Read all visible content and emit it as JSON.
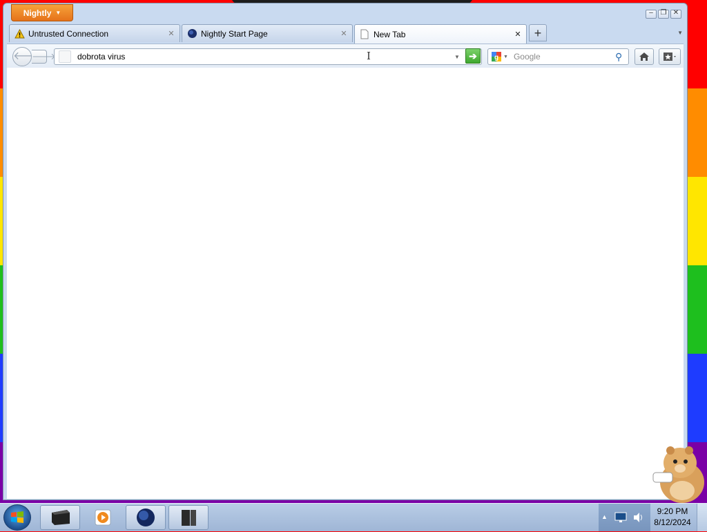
{
  "app": {
    "menu_label": "Nightly"
  },
  "tabs": [
    {
      "title": "Untrusted Connection",
      "icon": "warning-icon",
      "active": false
    },
    {
      "title": "Nightly Start Page",
      "icon": "nightly-globe-icon",
      "active": false
    },
    {
      "title": "New Tab",
      "icon": "blank-page-icon",
      "active": true
    }
  ],
  "navbar": {
    "url_value": "dobrota virus",
    "search_engine": "Google",
    "search_placeholder": "Google"
  },
  "taskbar": {
    "time": "9:20 PM",
    "date": "8/12/2024",
    "items": [
      "terminal-icon",
      "media-player-icon",
      "nightly-icon",
      "explorer-window-icon"
    ]
  },
  "colors": {
    "accent": "#e5721a",
    "go_button": "#3fa82f",
    "wallpaper_stripes": [
      "#ff0000",
      "#ff8c00",
      "#ffe600",
      "#1ebf1e",
      "#1e3cff",
      "#7a00a6"
    ]
  }
}
